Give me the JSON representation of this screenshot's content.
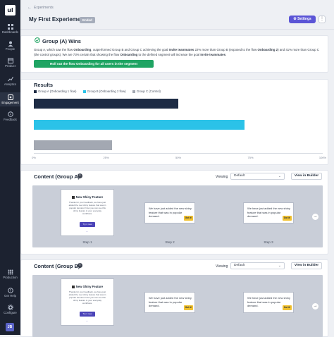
{
  "sidebar": {
    "logo": "ul",
    "items": [
      {
        "label": "Dashboards",
        "icon": "grid-icon"
      },
      {
        "label": "People",
        "icon": "people-icon"
      },
      {
        "label": "Product",
        "icon": "box-icon"
      },
      {
        "label": "Analytics",
        "icon": "chart-icon"
      },
      {
        "label": "Engagement",
        "icon": "engagement-icon"
      },
      {
        "label": "Feedback",
        "icon": "chat-icon"
      }
    ],
    "bottom_items": [
      {
        "label": "Production",
        "icon": "apps-icon"
      },
      {
        "label": "Get Help",
        "icon": "help-icon"
      },
      {
        "label": "Configure",
        "icon": "gear-icon"
      }
    ],
    "avatar": "JB"
  },
  "header": {
    "breadcrumb": "Experiments",
    "title": "My First Experiement",
    "badge": "Ended",
    "settings_label": "Settings",
    "more_label": "⋮"
  },
  "winner": {
    "title": "Group (A) Wins",
    "text_parts": [
      "Group A, which saw the flow ",
      "Onboarding",
      ", outperformed Group B and Group C achieving the goal ",
      "Invite teammates",
      " 22% more than Group B (exposed to the flow ",
      "Onboarding 2",
      ") and 41% more than Group C (the control groups). We are 73% certain that showing the flow ",
      "Onboarding",
      " to the defined segment will increase the goal ",
      "Invite teammates",
      "."
    ],
    "rollout_label": "Roll out the flow Onboarding for all users in the segment"
  },
  "results": {
    "title": "Results"
  },
  "chart_data": {
    "type": "bar",
    "orientation": "horizontal",
    "series": [
      {
        "name": "Group A (Onboarding 1 flow)",
        "value": 50,
        "color": "#1d2b44"
      },
      {
        "name": "Group B (Onboarding 2 flow)",
        "value": 73,
        "color": "#2bc2e8"
      },
      {
        "name": "Group C (Control)",
        "value": 27,
        "color": "#a3a8b2"
      }
    ],
    "xticks": [
      "0%",
      "25%",
      "50%",
      "75%",
      "100%"
    ],
    "xlim": [
      0,
      100
    ],
    "legend": "top-left",
    "grid": false
  },
  "content_sections": [
    {
      "title": "Content (Group A)",
      "viewing_label": "Viewing",
      "viewing_value": "Default",
      "builder_label": "View in Builder",
      "modal_title": "New Shiny Feature",
      "modal_body": "Thanks for your feedback, we have just added the new shiny feature that was in popular demand. Now you can use this shiny feature in your everyday workflows.",
      "modal_button": "Try it now",
      "tooltip_text": "We have just added the new shiny feature that was in popular demand.",
      "tooltip_button": "Got it!",
      "steps": [
        "Step 1",
        "Step 2",
        "Step 3"
      ],
      "next_icon": "→"
    },
    {
      "title": "Content (Group B)",
      "viewing_label": "Viewing",
      "viewing_value": "Default",
      "builder_label": "View in Builder",
      "modal_title": "New Shiny Feature",
      "modal_body": "Thanks for your feedback, we have just added the new shiny feature that was in popular demand. Now you can use this shiny feature in your everyday workflows.",
      "modal_button": "Try it now",
      "tooltip_text": "We have just added the new shiny feature that was in popular demand.",
      "tooltip_button": "Got it!",
      "steps": [
        "Step 1",
        "Step 2",
        "Step 3"
      ],
      "next_icon": "→"
    }
  ],
  "colors": {
    "sidebar": "#1c2230",
    "accent": "#5b55d6",
    "success": "#1fa463",
    "panel": "#c9ced8"
  }
}
